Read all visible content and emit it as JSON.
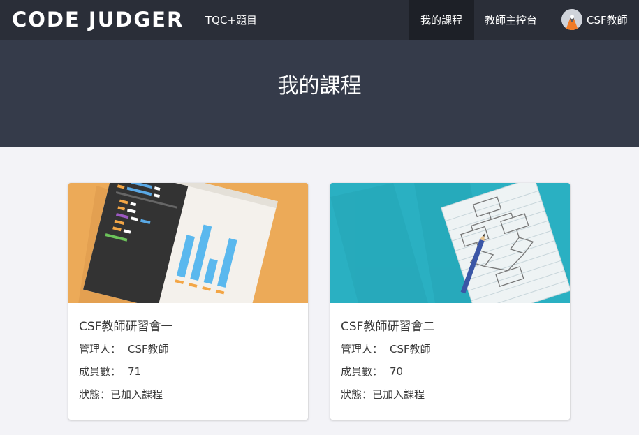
{
  "navbar": {
    "brand": "CODE JUDGER",
    "tqc_link": "TQC+題目",
    "my_courses": "我的課程",
    "teacher_console": "教師主控台",
    "user_name": "CSF教師"
  },
  "hero": {
    "title": "我的課程"
  },
  "courses": [
    {
      "name": "CSF教師研習會一",
      "manager_label": "管理人：",
      "manager": "CSF教師",
      "members_label": "成員數：",
      "members": "71",
      "status_label": "狀態：",
      "status": "已加入課程",
      "image_icon": "code-editor-chart-illustration"
    },
    {
      "name": "CSF教師研習會二",
      "manager_label": "管理人：",
      "manager": "CSF教師",
      "members_label": "成員數：",
      "members": "70",
      "status_label": "狀態：",
      "status": "已加入課程",
      "image_icon": "flowchart-illustration"
    }
  ],
  "colors": {
    "navbar_bg": "#2a2e38",
    "hero_bg": "#353b4a",
    "page_bg": "#f3f3f7",
    "card1_image_bg": "#ecaa58",
    "card2_image_bg": "#2ab0c2"
  }
}
